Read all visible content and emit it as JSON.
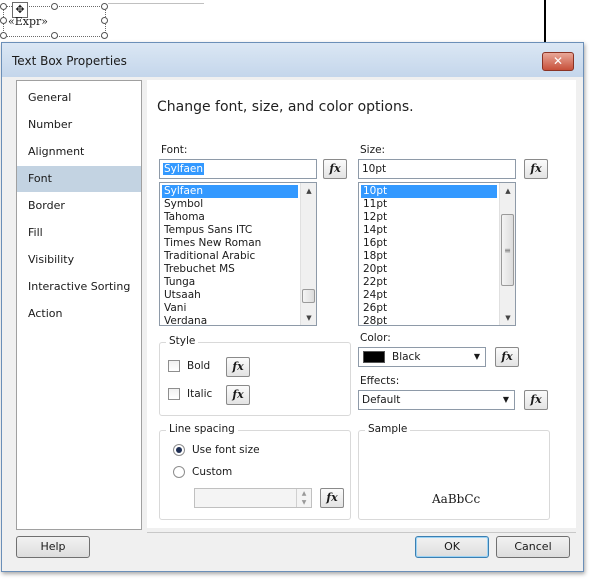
{
  "designer": {
    "expression_text": "«Expr»",
    "move_glyph": "✥"
  },
  "dialog": {
    "title": "Text Box Properties",
    "close_glyph": "✕",
    "nav": {
      "items": [
        {
          "label": "General"
        },
        {
          "label": "Number"
        },
        {
          "label": "Alignment"
        },
        {
          "label": "Font",
          "selected": true
        },
        {
          "label": "Border"
        },
        {
          "label": "Fill"
        },
        {
          "label": "Visibility"
        },
        {
          "label": "Interactive Sorting"
        },
        {
          "label": "Action"
        }
      ]
    },
    "heading": "Change font, size, and color options.",
    "fx_label": "fx",
    "font": {
      "label": "Font:",
      "value": "Sylfaen",
      "options": [
        "Sylfaen",
        "Symbol",
        "Tahoma",
        "Tempus Sans ITC",
        "Times New Roman",
        "Traditional Arabic",
        "Trebuchet MS",
        "Tunga",
        "Utsaah",
        "Vani",
        "Verdana"
      ],
      "selected": "Sylfaen"
    },
    "size": {
      "label": "Size:",
      "value": "10pt",
      "options": [
        "10pt",
        "11pt",
        "12pt",
        "14pt",
        "16pt",
        "18pt",
        "20pt",
        "22pt",
        "24pt",
        "26pt",
        "28pt"
      ],
      "selected": "10pt"
    },
    "style": {
      "title": "Style",
      "bold_label": "Bold",
      "italic_label": "Italic",
      "bold_checked": false,
      "italic_checked": false
    },
    "color": {
      "label": "Color:",
      "value": "Black",
      "swatch": "#000000"
    },
    "effects": {
      "label": "Effects:",
      "value": "Default"
    },
    "line_spacing": {
      "title": "Line spacing",
      "use_font_size_label": "Use font size",
      "custom_label": "Custom",
      "selected": "Use font size",
      "custom_value": ""
    },
    "sample": {
      "title": "Sample",
      "text": "AaBbCc"
    },
    "buttons": {
      "help": "Help",
      "ok": "OK",
      "cancel": "Cancel"
    },
    "accent_color": "#3399ff",
    "nav_selected_color": "#c3d3e2"
  }
}
